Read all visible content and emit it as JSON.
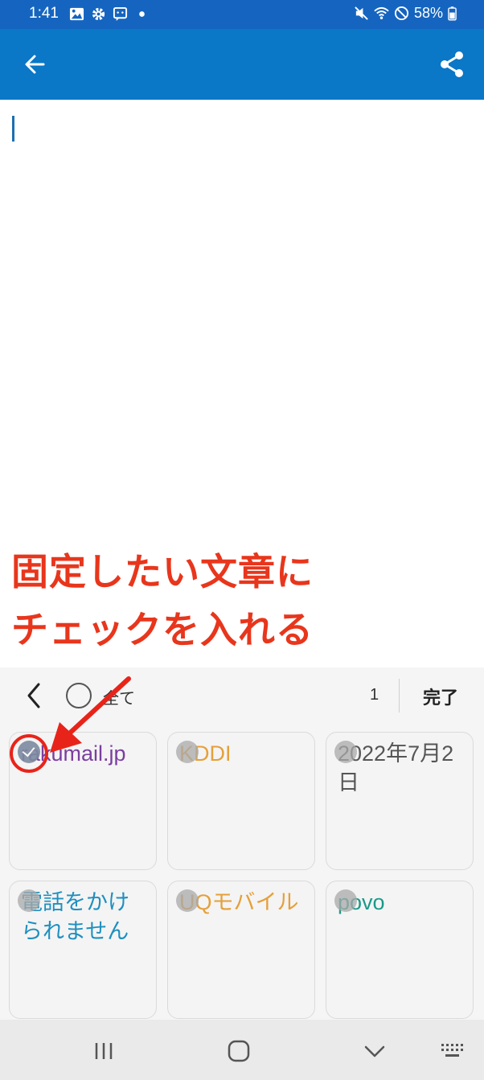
{
  "status_bar": {
    "time": "1:41",
    "left_icons": [
      "image-icon",
      "gear-icon",
      "message-icon",
      "dot-icon"
    ],
    "right_icons": [
      "mute-icon",
      "wifi-icon",
      "do-not-disturb-icon",
      "battery-icon"
    ],
    "battery": "58%"
  },
  "app_bar": {
    "color": "#0a77c7",
    "back_icon": "arrow-left-icon",
    "share_icon": "share-icon"
  },
  "annotation": {
    "line1": "固定したい文章に",
    "line2": "チェックを入れる",
    "color": "#e8361c"
  },
  "clipboard": {
    "select_all_label": "全て",
    "selected_count": "1",
    "done_label": "完了",
    "items": [
      {
        "text": "rakumail.jp",
        "checked": true,
        "color": "#7b3ea0"
      },
      {
        "text": "KDDI",
        "checked": false,
        "color": "#e5a03a"
      },
      {
        "text": "2022年7月2日",
        "checked": false,
        "color": "#555555"
      },
      {
        "text": "電話をかけられません",
        "checked": false,
        "color": "#1f8fbf"
      },
      {
        "text": "UQモバイル",
        "checked": false,
        "color": "#e5a03a"
      },
      {
        "text": "povo",
        "checked": false,
        "color": "#1a9a8a"
      }
    ]
  },
  "nav_bar": {
    "buttons": [
      "recent-apps-icon",
      "home-icon",
      "hide-keyboard-icon",
      "keyboard-switch-icon"
    ]
  }
}
